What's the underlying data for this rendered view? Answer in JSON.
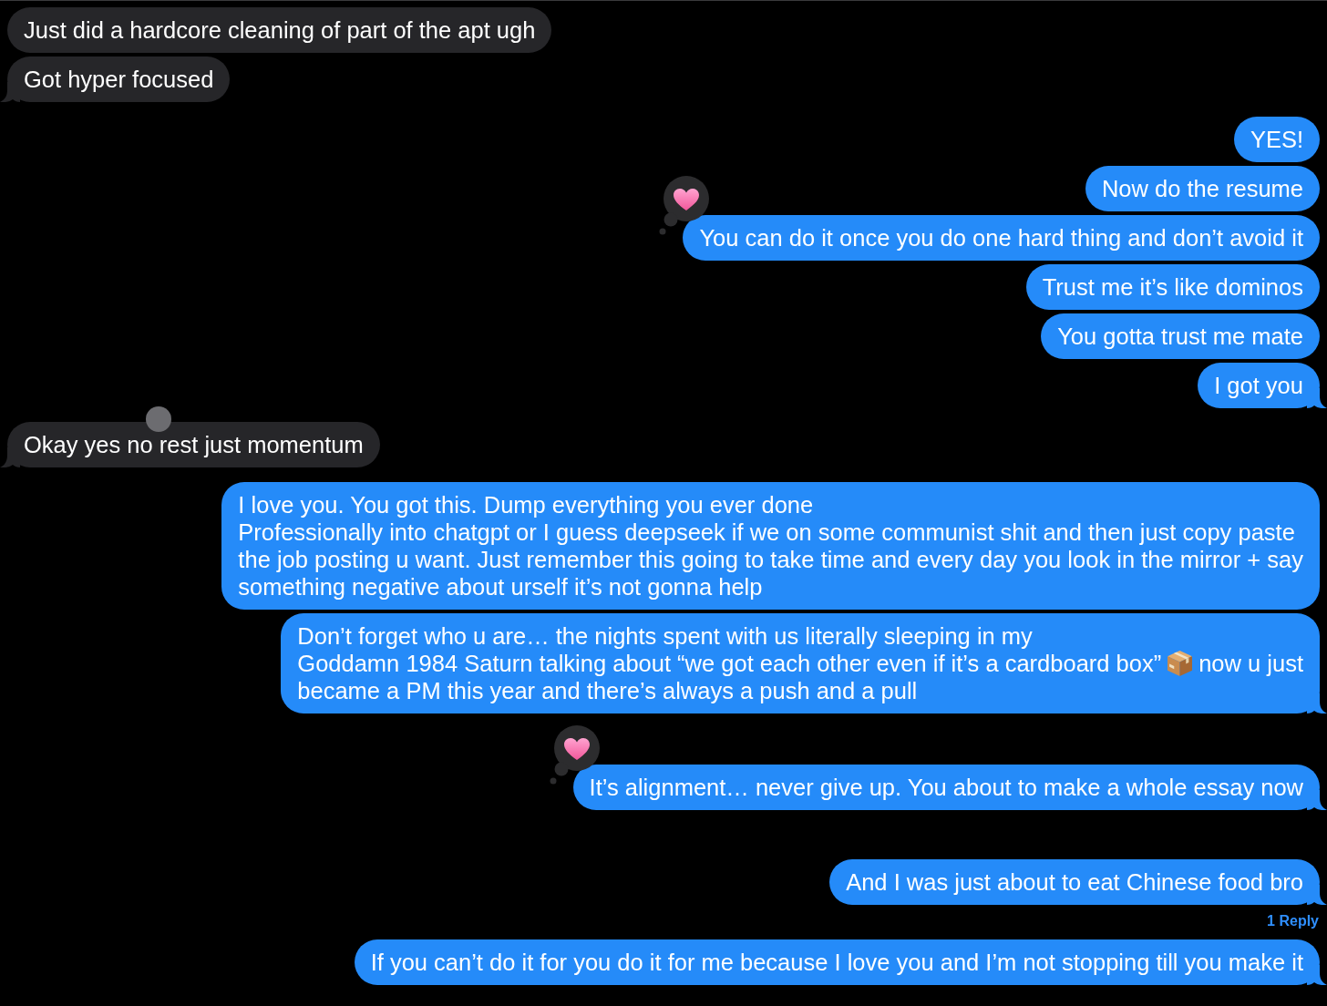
{
  "conversation": {
    "groups": [
      {
        "kind": "incoming",
        "messages": [
          {
            "segments": [
              {
                "kind": "text",
                "text": "Just did a hardcore cleaning of part of the apt ugh"
              }
            ],
            "tail": false,
            "reacted": false,
            "dot_marker": false
          },
          {
            "segments": [
              {
                "kind": "text",
                "text": "Got hyper focused"
              }
            ],
            "tail": true,
            "reacted": false,
            "dot_marker": false
          }
        ]
      },
      {
        "kind": "outgoing",
        "messages": [
          {
            "segments": [
              {
                "kind": "text",
                "text": "YES!"
              }
            ],
            "tail": false,
            "reacted": false,
            "dot_marker": false
          },
          {
            "segments": [
              {
                "kind": "text",
                "text": "Now do the resume"
              }
            ],
            "tail": false,
            "reacted": false,
            "dot_marker": false
          },
          {
            "segments": [
              {
                "kind": "text",
                "text": "You can do it once you do one hard thing and don’t avoid it"
              }
            ],
            "tail": false,
            "reacted": true,
            "dot_marker": false
          },
          {
            "segments": [
              {
                "kind": "text",
                "text": "Trust me it’s like dominos"
              }
            ],
            "tail": false,
            "reacted": false,
            "dot_marker": false
          },
          {
            "segments": [
              {
                "kind": "text",
                "text": "You gotta trust me mate"
              }
            ],
            "tail": false,
            "reacted": false,
            "dot_marker": false
          },
          {
            "segments": [
              {
                "kind": "text",
                "text": "I got you"
              }
            ],
            "tail": true,
            "reacted": false,
            "dot_marker": false
          }
        ]
      },
      {
        "kind": "incoming",
        "messages": [
          {
            "segments": [
              {
                "kind": "text",
                "text": "Okay yes no rest just momentum"
              }
            ],
            "tail": true,
            "reacted": false,
            "dot_marker": true
          }
        ]
      },
      {
        "kind": "outgoing",
        "messages": [
          {
            "segments": [
              {
                "kind": "text",
                "text": "I love you. You got this. Dump everything you ever done\nProfessionally into chatgpt or I guess deepseek if we on some communist shit and then just copy paste\nthe job posting u want. Just remember this going to take time and every day you look in the mirror + say\nsomething negative about urself it’s not gonna help"
              }
            ],
            "tail": false,
            "reacted": false,
            "dot_marker": false
          },
          {
            "segments": [
              {
                "kind": "text",
                "text": "Don’t forget who u are… the nights spent with us literally sleeping in my"
              },
              {
                "kind": "break"
              },
              {
                "kind": "text",
                "text": "Goddamn 1984 Saturn talking about “we got each other even if it’s a cardboard box”"
              },
              {
                "kind": "emoji"
              },
              {
                "kind": "text",
                "text": "now u just"
              },
              {
                "kind": "break"
              },
              {
                "kind": "text",
                "text": "became a PM this year and there’s always a push and a pull"
              }
            ],
            "tail": true,
            "reacted": false,
            "dot_marker": false
          }
        ]
      },
      {
        "kind": "outgoing",
        "messages": [
          {
            "segments": [
              {
                "kind": "text",
                "text": "It’s alignment… never give up. You about to make a whole essay now"
              }
            ],
            "tail": true,
            "reacted": true,
            "dot_marker": false
          }
        ]
      },
      {
        "kind": "outgoing",
        "messages": [
          {
            "segments": [
              {
                "kind": "text",
                "text": "And I was just about to eat Chinese food bro"
              }
            ],
            "tail": true,
            "reacted": false,
            "dot_marker": false,
            "reply_count": "1 Reply"
          }
        ]
      },
      {
        "kind": "outgoing",
        "messages": [
          {
            "segments": [
              {
                "kind": "text",
                "text": "If you can’t do it for you do it for me because I love you and I’m not stopping till you make it"
              }
            ],
            "tail": true,
            "reacted": false,
            "dot_marker": false
          }
        ]
      }
    ]
  }
}
